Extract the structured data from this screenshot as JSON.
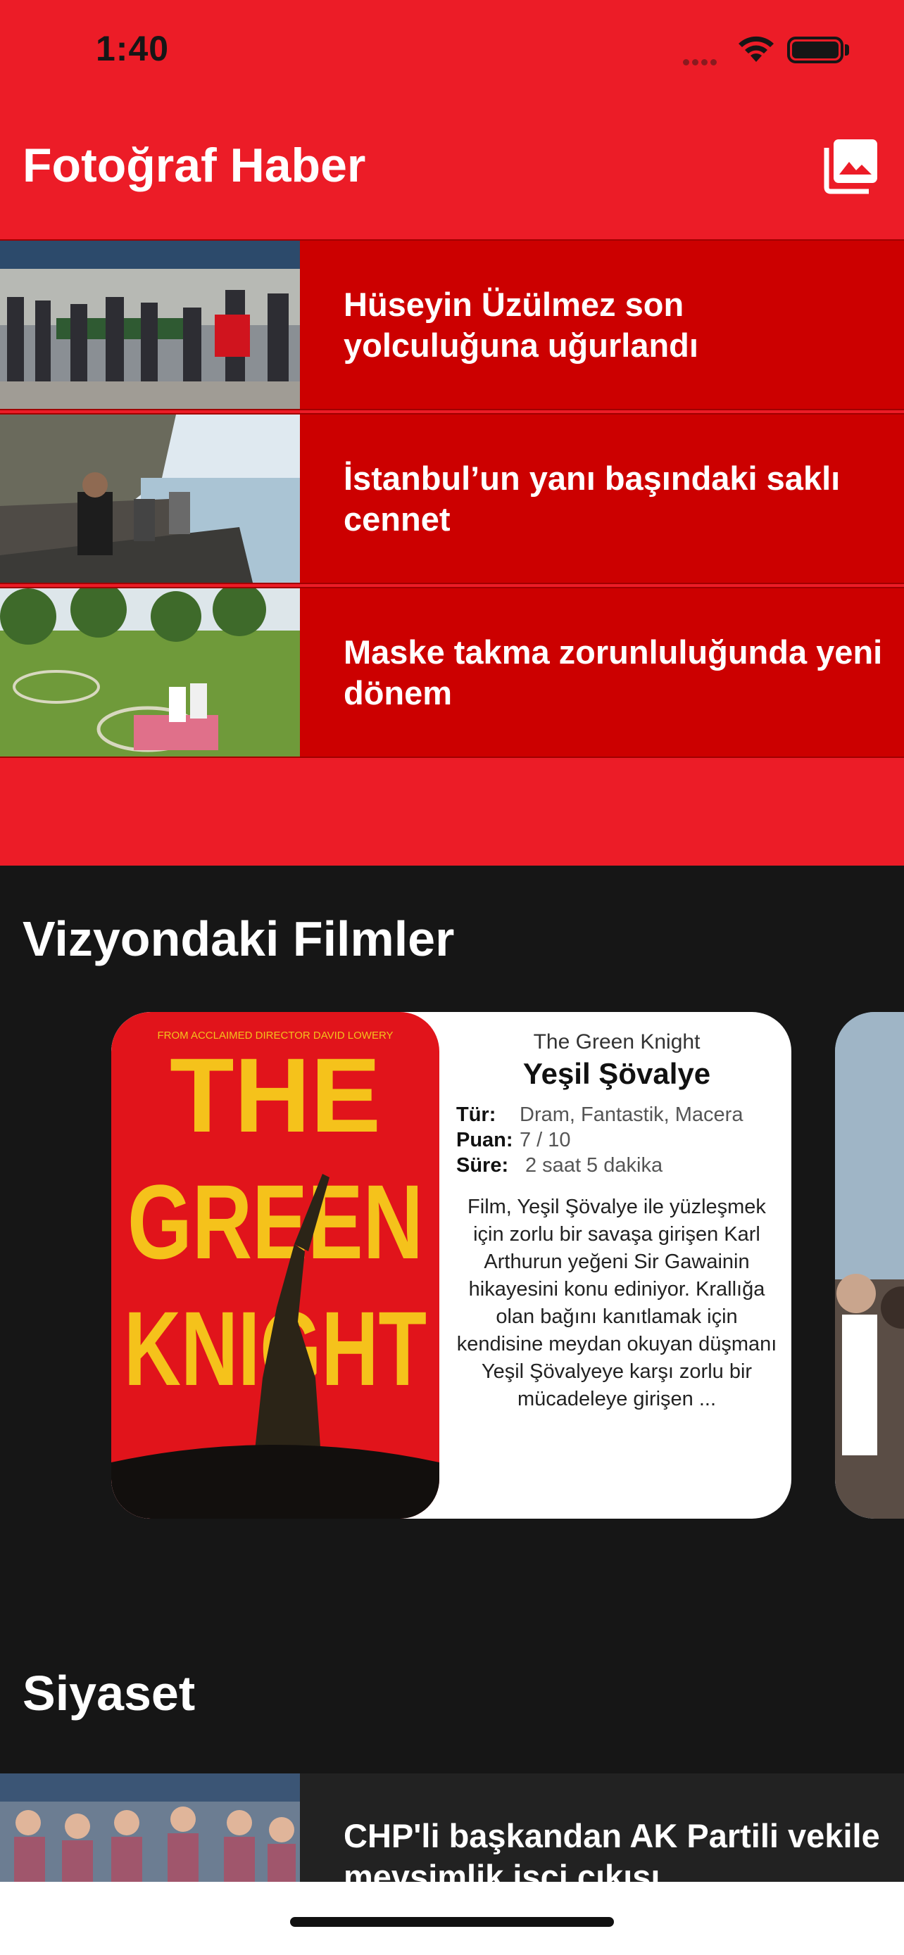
{
  "status_bar": {
    "time": "1:40"
  },
  "photo_news": {
    "title": "Fotoğraf Haber",
    "items": [
      {
        "title": "Hüseyin Üzülmez son yolculuğuna uğurlandı"
      },
      {
        "title": "İstanbul’un yanı başındaki saklı cennet"
      },
      {
        "title": "Maske takma zorunluluğunda yeni dönem"
      }
    ]
  },
  "movies": {
    "title": "Vizyondaki Filmler",
    "card": {
      "original_title": "The Green Knight",
      "title": "Yeşil Şövalye",
      "genre_label": "Tür:",
      "genre": "Dram, Fantastik, Macera",
      "rating_label": "Puan:",
      "rating": "7 / 10",
      "duration_label": "Süre:",
      "duration": "2 saat 5 dakika",
      "description": "Film, Yeşil Şövalye ile yüzleşmek için zorlu bir savaşa girişen Karl Arthurun yeğeni Sir Gawainin hikayesini konu ediniyor. Krallığa olan bağını kanıtlamak için kendisine meydan okuyan düşmanı Yeşil Şövalyeye karşı zorlu bir mücadeleye girişen ...",
      "poster_top_text": "FROM ACCLAIMED DIRECTOR DAVID LOWERY",
      "poster_line1": "THE",
      "poster_line2": "GREEN",
      "poster_line3": "KNIGHT"
    }
  },
  "politics": {
    "title": "Siyaset",
    "items": [
      {
        "title": "CHP'li başkandan AK Partili vekile mevsimlik işçi çıkışı"
      }
    ]
  },
  "colors": {
    "brand_red": "#ec1c27",
    "row_red": "#cc0000",
    "dark_bg": "#161616"
  },
  "icons": {
    "gallery": "photo-library-icon",
    "wifi": "wifi-icon",
    "battery": "battery-icon"
  }
}
